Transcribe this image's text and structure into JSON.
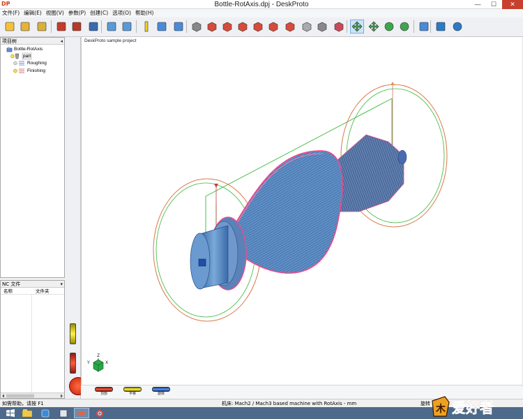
{
  "window": {
    "app_logo": "DP",
    "title": "Bottle-RotAxis.dpj - DeskProto",
    "minimize": "—",
    "maximize": "☐",
    "close": "✕"
  },
  "menu": [
    "文件(F)",
    "编辑(E)",
    "视图(V)",
    "参数(P)",
    "创建(C)",
    "选项(O)",
    "帮助(H)"
  ],
  "toolbar": {
    "buttons": [
      {
        "name": "new-file-icon",
        "color": "#f4c23a"
      },
      {
        "name": "open-folder-icon",
        "color": "#e5b33a"
      },
      {
        "name": "save-icon",
        "color": "#d8b03a"
      },
      {
        "name": "import-part-icon",
        "color": "#c83a2a"
      },
      {
        "name": "toolpath-icon",
        "color": "#b53a2a"
      },
      {
        "name": "nc-save-icon",
        "color": "#3a6ab0"
      },
      {
        "name": "simulate-icon",
        "color": "#5a9ad8"
      },
      {
        "name": "preview-icon",
        "color": "#5a9ad8"
      },
      {
        "name": "tool-icon",
        "color": "#f4d020"
      },
      {
        "name": "layout-icon",
        "color": "#4a8ad8"
      },
      {
        "name": "split-view-icon",
        "color": "#4a8ad8"
      },
      {
        "name": "camera-icon",
        "color": "#888888"
      },
      {
        "name": "view-front-icon",
        "color": "#d84a3a"
      },
      {
        "name": "view-back-icon",
        "color": "#d84a3a"
      },
      {
        "name": "view-left-icon",
        "color": "#d84a3a"
      },
      {
        "name": "view-right-icon",
        "color": "#d84a3a"
      },
      {
        "name": "view-top-icon",
        "color": "#d84a3a"
      },
      {
        "name": "view-bottom-icon",
        "color": "#d84a3a"
      },
      {
        "name": "view-iso-icon",
        "color": "#aaaaaa"
      },
      {
        "name": "view-iso2-icon",
        "color": "#888888"
      },
      {
        "name": "shaded-icon",
        "color": "#c84a5a"
      },
      {
        "name": "pan-icon",
        "color": "#3aa84a"
      },
      {
        "name": "move-icon",
        "color": "#3aa84a"
      },
      {
        "name": "zoom-icon",
        "color": "#3aa84a"
      },
      {
        "name": "zoom-window-icon",
        "color": "#3aa84a"
      },
      {
        "name": "zoom-100-icon",
        "color": "#4a8ad8"
      },
      {
        "name": "book-icon",
        "color": "#2a7ac8"
      },
      {
        "name": "help-icon",
        "color": "#2a7ac8"
      }
    ],
    "active_button": "pan-icon"
  },
  "project_tree": {
    "header": "项目树",
    "pin": "◂",
    "items": [
      {
        "label": "Bottle-RotAxis",
        "icon": "project-icon"
      },
      {
        "label": "part",
        "icon": "part-icon"
      },
      {
        "label": "Roughing",
        "icon": "operation-icon"
      },
      {
        "label": "Finishing",
        "icon": "operation-icon"
      }
    ]
  },
  "nc_panel": {
    "header": "NC 文件",
    "dropdown": "▾",
    "columns": [
      "名称",
      "文件夹"
    ]
  },
  "viewport": {
    "label": "DeskProto sample project",
    "axis_labels": {
      "x": "X",
      "y": "Y",
      "z": "Z"
    },
    "colors": {
      "model": "#4e81bd",
      "toolpath": "#f04a8a",
      "rot_circle": "#d87848",
      "boundary": "#3ab83a"
    }
  },
  "view_buttons": [
    {
      "label": "顶部",
      "color": "#e23a2a"
    },
    {
      "label": "平移",
      "color": "#e0d020"
    },
    {
      "label": "旋转",
      "color": "#3a7ad8"
    }
  ],
  "status": {
    "help": "如需帮助，请按 F1",
    "machine": "机床: Mach2 / Mach3 based machine with RotAxis - mm",
    "rotate": "旋转"
  },
  "watermark_text": "爱好者",
  "watermark_logo": "木"
}
